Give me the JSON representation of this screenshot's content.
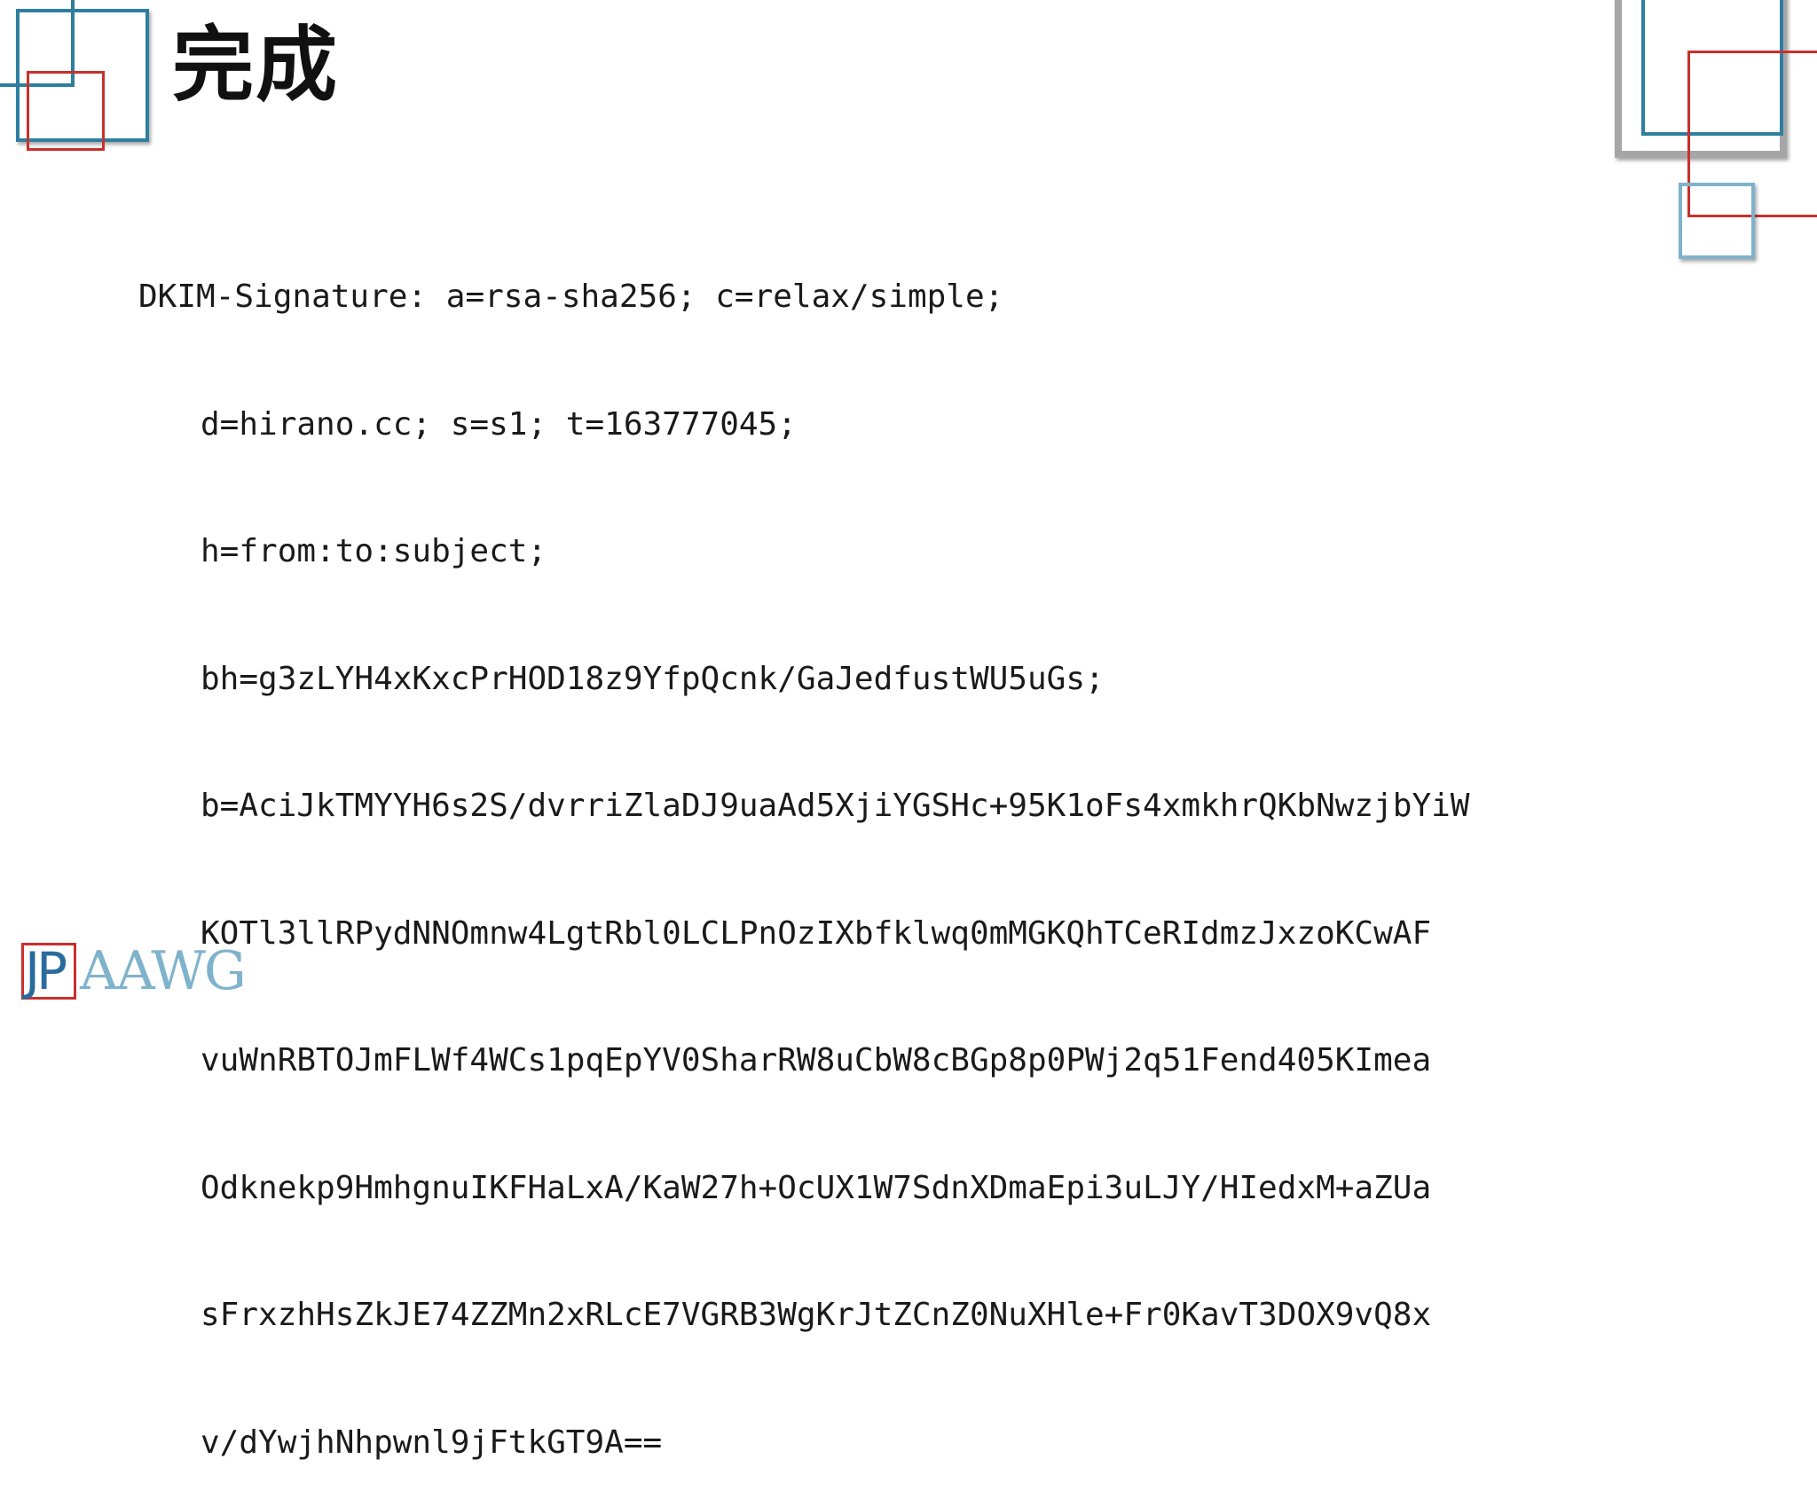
{
  "slide": {
    "title": "完成",
    "code_lines": [
      "DKIM-Signature: a=rsa-sha256; c=relax/simple;",
      "d=hirano.cc; s=s1; t=163777045;",
      "h=from:to:subject;",
      "bh=g3zLYH4xKxcPrHOD18z9YfpQcnk/GaJedfustWU5uGs;",
      "b=AciJkTMYYH6s2S/dvrriZlaDJ9uaAd5XjiYGSHc+95K1oFs4xmkhrQKbNwzjbYiW",
      "KOTl3llRPydNNOmnw4LgtRbl0LCLPnOzIXbfklwq0mMGKQhTCeRIdmzJxzoKCwAF",
      "vuWnRBTOJmFLWf4WCs1pqEpYV0SharRW8uCbW8cBGp8p0PWj2q51Fend405KImea",
      "Odknekp9HmhgnuIKFHaLxA/KaW27h+OcUX1W7SdnXDmaEpi3uLJY/HIedxM+aZUa",
      "sFrxzhHsZkJE74ZZMn2xRLcE7VGRB3WgKrJtZCnZ0NuXHle+Fr0KavT3DOX9vQ8x",
      "v/dYwjhNhpwnl9jFtkGT9A=="
    ]
  },
  "logo": {
    "jp": "JP",
    "rest": "AAWG"
  },
  "colors": {
    "blue": "#2f7ea0",
    "light_blue": "#7fb2cc",
    "red": "#c9302c",
    "gray": "#a6a6a6"
  }
}
